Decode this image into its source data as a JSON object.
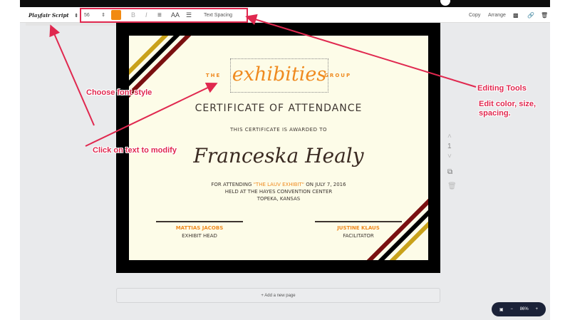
{
  "toolbar": {
    "font": "Playfair Script",
    "size": "56",
    "color": "#f28a12",
    "bold": "B",
    "italic": "I",
    "align": "≡",
    "case": "AA",
    "list": "☰",
    "spacing": "Text Spacing",
    "copy": "Copy",
    "arrange": "Arrange"
  },
  "certificate": {
    "group_left": "THE",
    "logo": "exhibities",
    "group_right": "GROUP",
    "title": "CERTIFICATE OF ATTENDANCE",
    "awarded": "THIS CERTIFICATE IS AWARDED TO",
    "name": "Franceska Healy",
    "line1_a": "FOR ATTENDING ",
    "line1_b": "\"THE LAUV EXHIBIT\"",
    "line1_c": " ON JULY 7, 2016",
    "line2": "HELD AT THE HAYES CONVENTION CENTER",
    "line3": "TOPEKA, KANSAS",
    "sig1_name": "MATTIAS JACOBS",
    "sig1_role": "EXHIBIT HEAD",
    "sig2_name": "JUSTINE KLAUS",
    "sig2_role": "FACILITATOR"
  },
  "page_controls": {
    "page_number": "1"
  },
  "add_page": "+ Add a new page",
  "zoom": {
    "level": "86%",
    "minus": "−",
    "plus": "+"
  },
  "annotations": {
    "font_style": "Choose font style",
    "click_text": "Click on text to modify",
    "editing_tools": "Editing Tools",
    "edit_desc": "Edit color, size, spacing."
  },
  "colors": {
    "accent": "#ef8a1f",
    "annotation": "#e0284f",
    "stripe_red": "#7a1010",
    "stripe_gold": "#c9a21a"
  }
}
